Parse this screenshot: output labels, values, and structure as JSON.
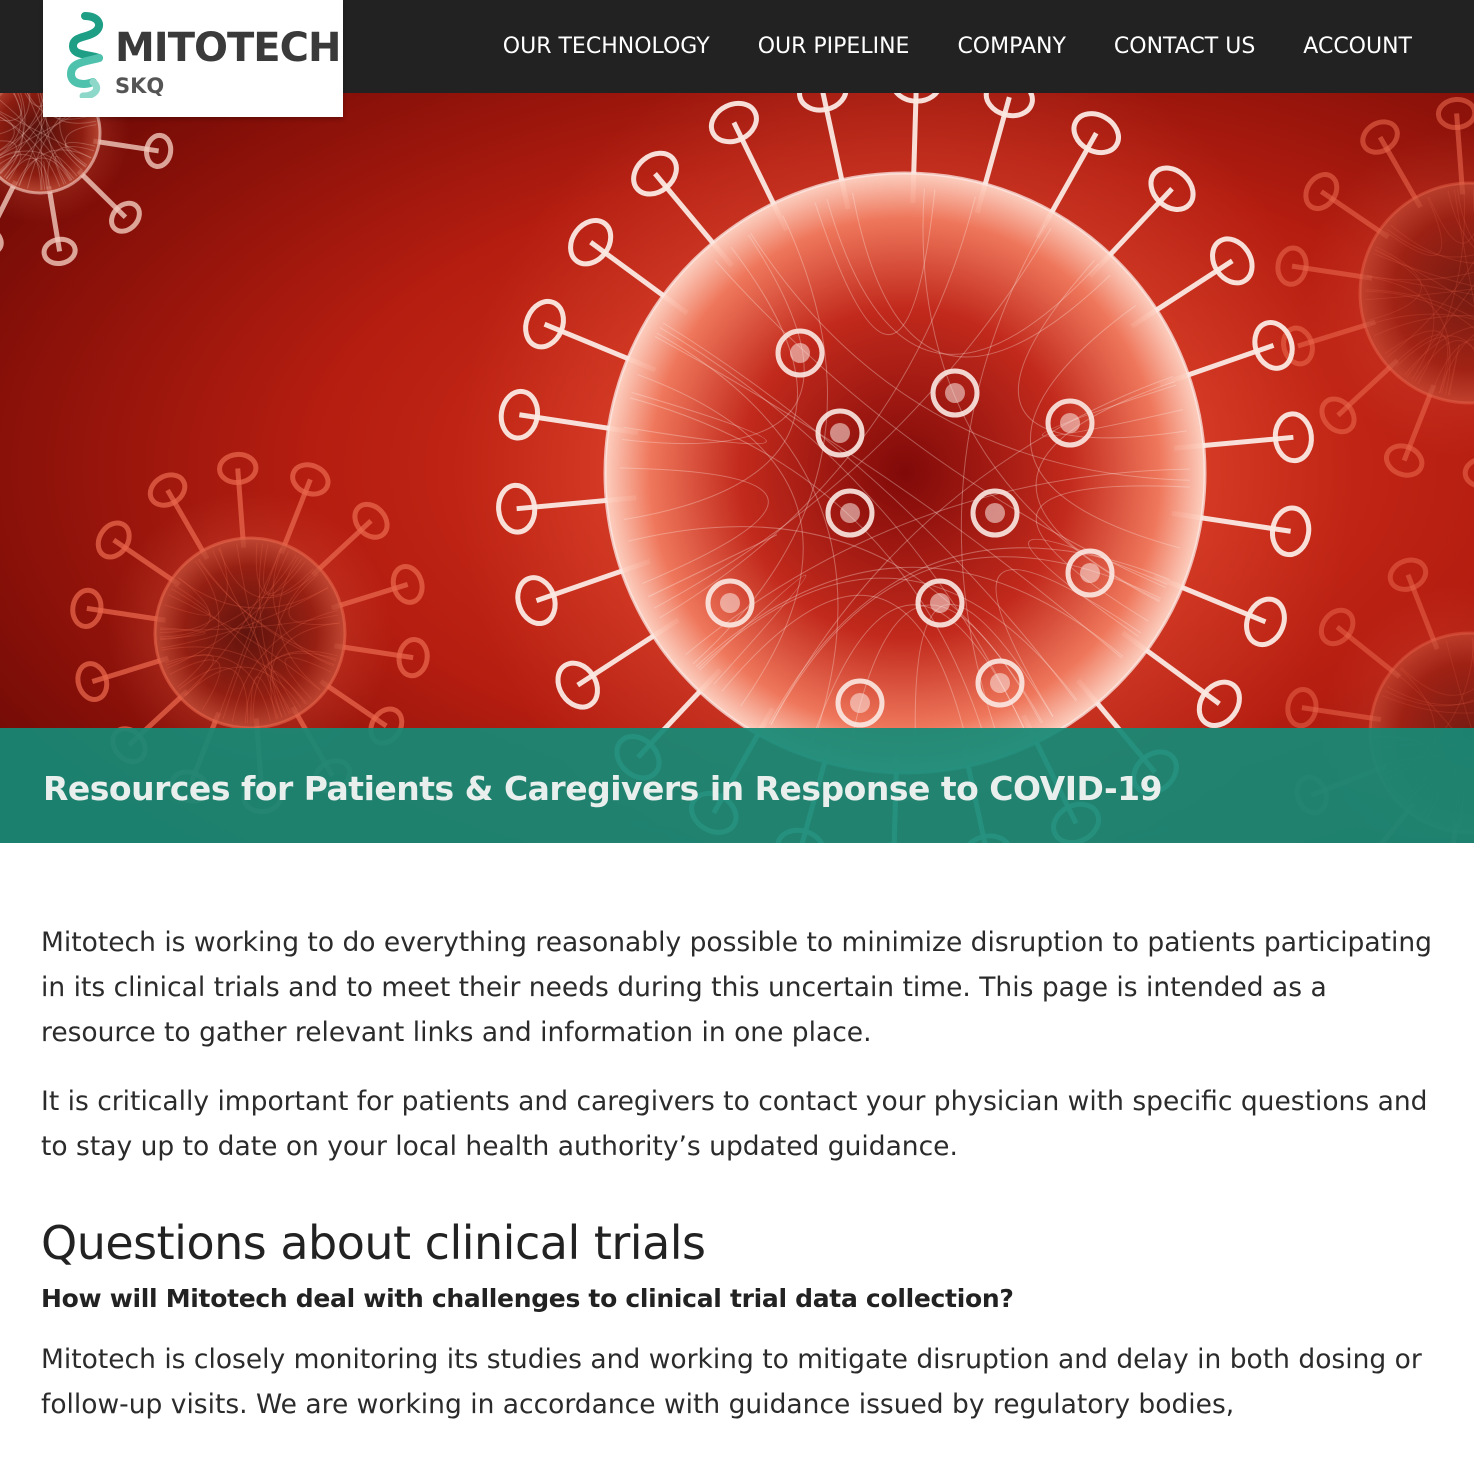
{
  "header": {
    "logo": {
      "name": "MITOTECH",
      "sub": "SKQ"
    },
    "nav": [
      {
        "label": "OUR TECHNOLOGY"
      },
      {
        "label": "OUR PIPELINE"
      },
      {
        "label": "COMPANY"
      },
      {
        "label": "CONTACT US"
      },
      {
        "label": "ACCOUNT"
      }
    ]
  },
  "hero": {
    "title": "Resources for Patients & Caregivers in Response to COVID-19",
    "band_color": "#168a76",
    "background_color": "#9a1209"
  },
  "content": {
    "intro": [
      "Mitotech is working to do everything reasonably possible to minimize disruption to patients participating in its clinical trials and to meet their needs during this uncertain time. This page is intended as a resource to gather relevant links and information in one place.",
      "It is critically important for patients and caregivers to contact your physician with specific questions and to stay up to date on your local health authority’s updated guidance."
    ],
    "section_title": "Questions about clinical trials",
    "question": "How will Mitotech deal with challenges to clinical trial data collection?",
    "answer": "Mitotech is closely monitoring its studies and working to mitigate disruption and delay in both dosing or follow-up visits. We are working in accordance with guidance issued by regulatory bodies,"
  }
}
